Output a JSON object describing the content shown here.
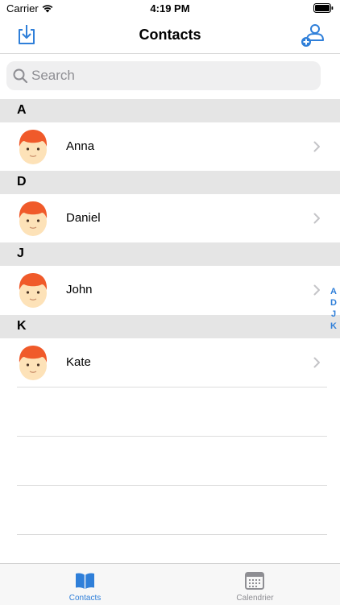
{
  "status": {
    "carrier": "Carrier",
    "time": "4:19 PM"
  },
  "nav": {
    "title": "Contacts",
    "left_icon": "import-icon",
    "right_icon": "add-contact-icon"
  },
  "search": {
    "placeholder": "Search",
    "value": ""
  },
  "sections": [
    {
      "letter": "A",
      "contacts": [
        {
          "name": "Anna"
        }
      ]
    },
    {
      "letter": "D",
      "contacts": [
        {
          "name": "Daniel"
        }
      ]
    },
    {
      "letter": "J",
      "contacts": [
        {
          "name": "John"
        }
      ]
    },
    {
      "letter": "K",
      "contacts": [
        {
          "name": "Kate"
        }
      ]
    }
  ],
  "index": [
    "A",
    "D",
    "J",
    "K"
  ],
  "tabs": [
    {
      "label": "Contacts",
      "icon": "book-icon",
      "selected": true
    },
    {
      "label": "Calendrier",
      "icon": "calendar-icon",
      "selected": false
    }
  ],
  "colors": {
    "accent": "#2f7fd9",
    "inactive": "#8e8e93",
    "header_bg": "#e5e5e5",
    "avatar_hair": "#f05a2a",
    "avatar_skin": "#fde2b8"
  }
}
